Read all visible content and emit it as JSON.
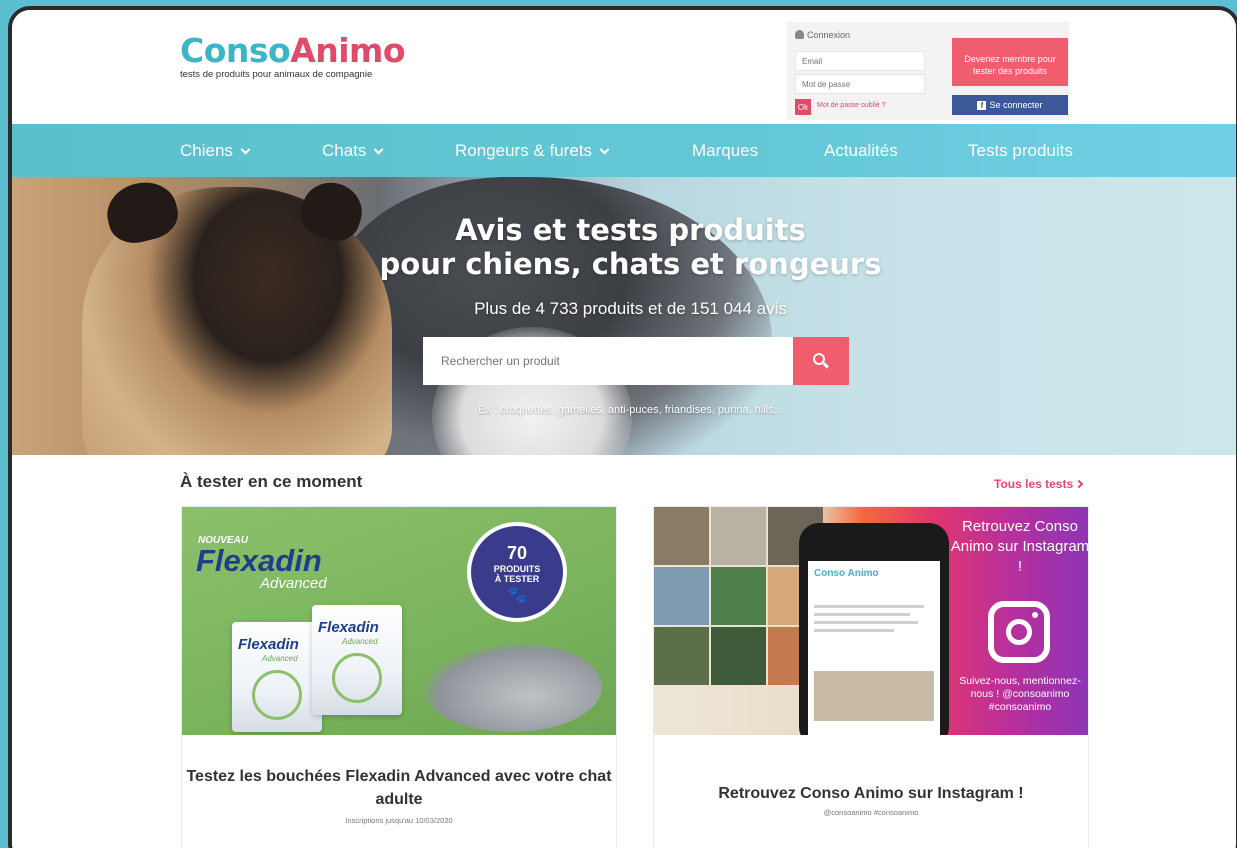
{
  "logo": {
    "name_part1": "Conso",
    "name_part2": "Animo",
    "tagline": "tests de produits pour animaux de compagnie"
  },
  "login": {
    "title": "Connexion",
    "email_placeholder": "Email",
    "password_placeholder": "Mot de passe",
    "ok_label": "Ok",
    "forgot_label": "Mot de passe oublié ?"
  },
  "member": {
    "become_member_label": "Devenez membre pour tester des produits",
    "facebook_label": "Se connecter"
  },
  "nav": {
    "items": [
      {
        "label": "Chiens",
        "dropdown": true
      },
      {
        "label": "Chats",
        "dropdown": true
      },
      {
        "label": "Rongeurs & furets",
        "dropdown": true
      },
      {
        "label": "Marques",
        "dropdown": false
      },
      {
        "label": "Actualités",
        "dropdown": false
      },
      {
        "label": "Tests produits",
        "dropdown": false
      }
    ]
  },
  "hero": {
    "title_line1": "Avis et tests produits",
    "title_line2": "pour chiens, chats et rongeurs",
    "subtitle": "Plus de 4 733 produits et de 151 044 avis",
    "search_placeholder": "Rechercher un produit",
    "examples": "Ex : croquettes, gamelles, anti-puces, friandises, purina, hills..."
  },
  "tests": {
    "section_title": "À tester en ce moment",
    "all_tests_label": "Tous les tests",
    "cards": [
      {
        "title": "Testez les bouchées Flexadin Advanced avec votre chat adulte",
        "meta": "Inscriptions jusqu'au 10/03/2020",
        "image": {
          "nouveau": "NOUVEAU",
          "brand": "Flexadin",
          "product_line": "Advanced",
          "badge_number": "70",
          "badge_text1": "PRODUITS",
          "badge_text2": "À TESTER"
        }
      },
      {
        "title": "Retrouvez Conso Animo sur Instagram !",
        "meta": "@consoanimo #consoanimo",
        "image": {
          "headline": "Retrouvez Conso Animo sur Instagram !",
          "follow_text": "Suivez-nous, mentionnez-nous ! @consoanimo #consoanimo",
          "phone_brand": "Conso Animo"
        }
      }
    ]
  },
  "colors": {
    "brand_teal": "#3cb6c6",
    "brand_pink": "#e24a6a",
    "nav_bg": "#63c7d6",
    "cta_red": "#ef5d6e",
    "facebook": "#3b5998"
  }
}
